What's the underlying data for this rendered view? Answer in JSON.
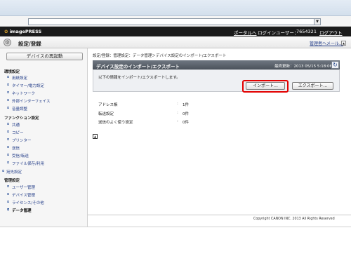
{
  "browser": {
    "dropdown_arrow": "▼"
  },
  "appbar": {
    "logo_text": "imagePRESS",
    "portal_link": "ポータルへ",
    "user_label": "ログインユーザー：",
    "user_name": "7654321",
    "logout_link": "ログアウト"
  },
  "header": {
    "title": "設定/登録",
    "manager_link": "管理者ヘメール..."
  },
  "sidebar": {
    "restart_button": "デバイスの再起動",
    "sections": [
      {
        "label": "環境設定",
        "items": [
          "用紙設定",
          "タイマー/電力設定",
          "ネットワーク",
          "外部インターフェイス",
          "音量調整"
        ]
      },
      {
        "label": "ファンクション設定",
        "items": [
          "共通",
          "コピー",
          "プリンター",
          "送信",
          "受信/転送",
          "ファイル保存/利用"
        ]
      },
      {
        "label": "宛先設定",
        "items": []
      },
      {
        "label": "管理設定",
        "items": [
          "ユーザー管理",
          "デバイス管理",
          "ライセンス/その他",
          "データ管理"
        ]
      }
    ],
    "active_item": "データ管理"
  },
  "main": {
    "breadcrumb": "設定/登録：管理設定：データ管理＞デバイス設定のインポート/エクスポート",
    "panel_title": "デバイス設定のインポート/エクスポート",
    "updated_text": "最終更新：2013 05/15 5:18:06",
    "description": "以下の情報をインポート/エクスポートします。",
    "import_button": "インポート...",
    "export_button": "エクスポート...",
    "rows": [
      {
        "label": "アドレス帳",
        "value": "1件"
      },
      {
        "label": "転送設定",
        "value": "0件"
      },
      {
        "label": "送信のよく使う設定",
        "value": "0件"
      }
    ],
    "separator": ":"
  },
  "footer": {
    "copyright": "Copyright CANON INC. 2013 All Rights Reserved"
  },
  "colors": {
    "appbar": "#1b1b1b",
    "panel_title": "#545c66",
    "link": "#223c88",
    "highlight": "#e30000"
  }
}
